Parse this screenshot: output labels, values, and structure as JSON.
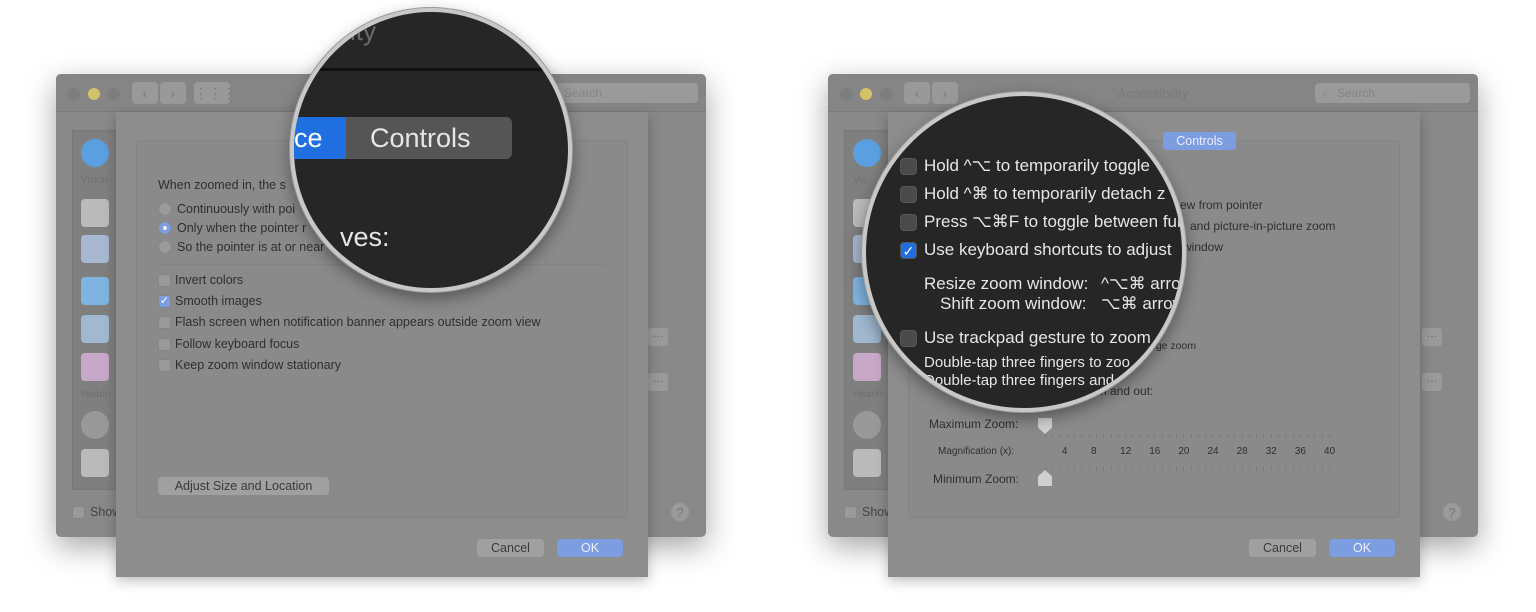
{
  "left": {
    "window": {
      "search_placeholder": "Search"
    },
    "sidebar": {
      "vision_label": "Vision",
      "hearing_label": "Hearin",
      "show_label": "Show"
    },
    "sheet": {
      "heading": "When zoomed in, the s",
      "radios": [
        {
          "label": "Continuously with poi",
          "selected": false
        },
        {
          "label": "Only when the pointer r",
          "selected": true
        },
        {
          "label": "So the pointer is at or near",
          "selected": false
        }
      ],
      "checkboxes": [
        {
          "label": "Invert colors",
          "checked": false
        },
        {
          "label": "Smooth images",
          "checked": true
        },
        {
          "label": "Flash screen when notification banner appears outside zoom view",
          "checked": false
        },
        {
          "label": "Follow keyboard focus",
          "checked": false
        },
        {
          "label": "Keep zoom window stationary",
          "checked": false
        }
      ],
      "adjust_button": "Adjust Size and Location",
      "cancel": "Cancel",
      "ok": "OK"
    },
    "magnifier": {
      "title_fragment": "bility",
      "tab_active_fragment": "ce",
      "tab_controls": "Controls",
      "text_fragment": "ves:"
    }
  },
  "right": {
    "window": {
      "title": "Accessibility",
      "search_placeholder": "Search"
    },
    "sidebar": {
      "vision_label": "Vis",
      "hearing_label": "Hearin",
      "show_label": "Show"
    },
    "sheet": {
      "tab_controls": "Controls",
      "fragments": {
        "f1": "ew from pointer",
        "f2": "and picture-in-picture zoom",
        "f3": "window",
        "f4": "nge zoom",
        "f5": "n and out:"
      },
      "max_zoom_label": "Maximum Zoom:",
      "magnification_label": "Magnification (x):",
      "min_zoom_label": "Minimum Zoom:",
      "magnification_ticks": [
        "4",
        "8",
        "12",
        "16",
        "20",
        "24",
        "28",
        "32",
        "36",
        "40"
      ],
      "max_zoom_value": 1,
      "min_zoom_value": 1,
      "cancel": "Cancel",
      "ok": "OK"
    },
    "magnifier": {
      "options": [
        {
          "label": "Hold ^⌥ to temporarily toggle",
          "checked": false
        },
        {
          "label": "Hold ^⌘ to temporarily detach z",
          "checked": false
        },
        {
          "label": "Press ⌥⌘F to toggle between full",
          "checked": false
        },
        {
          "label": "Use keyboard shortcuts to adjust",
          "checked": true
        }
      ],
      "resize_label": "Resize zoom window:",
      "resize_keys": "^⌥⌘ arro",
      "shift_label": "Shift zoom window:",
      "shift_keys": "⌥⌘ arrow",
      "trackpad_label": "Use trackpad gesture to zoom",
      "trackpad_checked": false,
      "double_tap_1": "Double-tap three fingers to zoo",
      "double_tap_2": "Double-tap three fingers and"
    }
  },
  "colors": {
    "accent": "#1f6fe0",
    "dim_accent": "#7c9ee0",
    "magnifier_bg": "#262626"
  }
}
